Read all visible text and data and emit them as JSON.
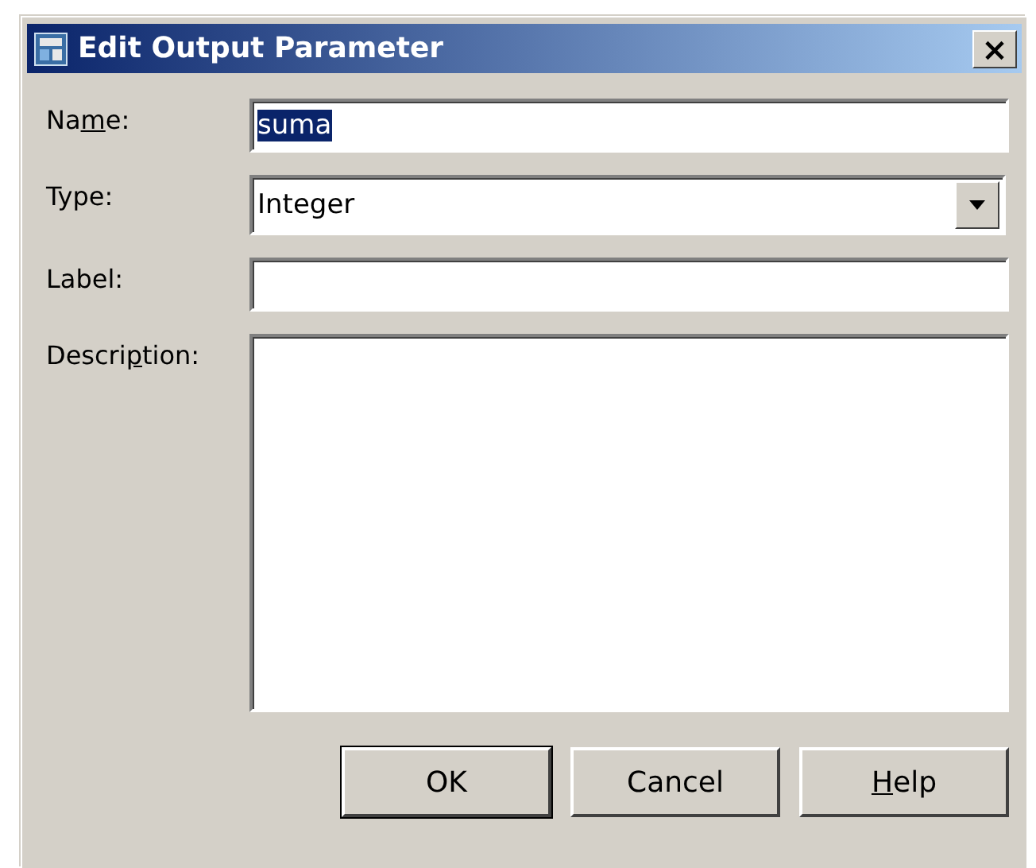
{
  "window": {
    "title": "Edit Output Parameter",
    "close": "×"
  },
  "fields": [
    {
      "kind": "text",
      "label_parts": [
        {
          "text": "Na",
          "underlined": false
        },
        {
          "text": "m",
          "underlined": true
        },
        {
          "text": "e:",
          "underlined": false
        }
      ],
      "value": "suma",
      "selected": true
    },
    {
      "kind": "combo",
      "label_parts": [
        {
          "text": "Type:",
          "underlined": false
        }
      ],
      "value": "Integer"
    },
    {
      "kind": "text",
      "label_parts": [
        {
          "text": "Label:",
          "underlined": false
        }
      ]
    },
    {
      "kind": "area",
      "label_parts": [
        {
          "text": "Descri",
          "underlined": false
        },
        {
          "text": "p",
          "underlined": true
        },
        {
          "text": "tion:",
          "underlined": false
        }
      ]
    }
  ],
  "buttons": [
    {
      "label_parts": [
        {
          "text": "OK",
          "underlined": false
        }
      ]
    },
    {
      "label_parts": [
        {
          "text": "Cancel",
          "underlined": false
        }
      ]
    },
    {
      "label_parts": [
        {
          "text": "H",
          "underlined": true
        },
        {
          "text": "elp",
          "underlined": false
        }
      ]
    }
  ]
}
